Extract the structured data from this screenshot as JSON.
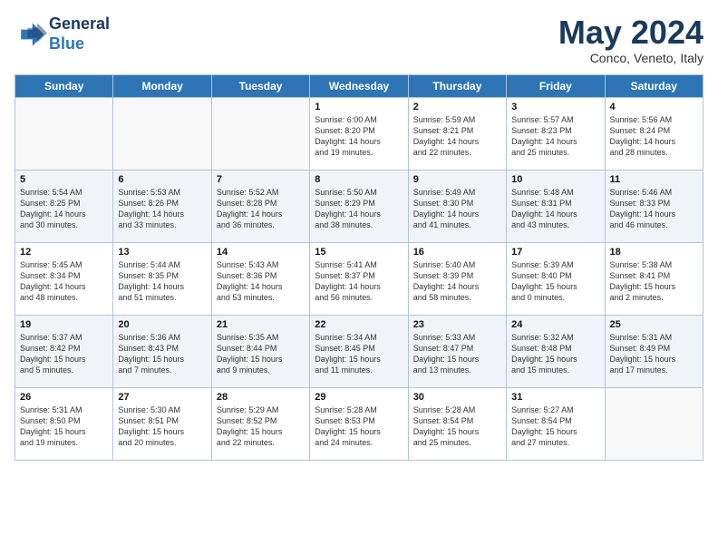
{
  "header": {
    "logo_line1": "General",
    "logo_line2": "Blue",
    "month": "May 2024",
    "location": "Conco, Veneto, Italy"
  },
  "days_of_week": [
    "Sunday",
    "Monday",
    "Tuesday",
    "Wednesday",
    "Thursday",
    "Friday",
    "Saturday"
  ],
  "weeks": [
    [
      {
        "day": "",
        "info": ""
      },
      {
        "day": "",
        "info": ""
      },
      {
        "day": "",
        "info": ""
      },
      {
        "day": "1",
        "info": "Sunrise: 6:00 AM\nSunset: 8:20 PM\nDaylight: 14 hours\nand 19 minutes."
      },
      {
        "day": "2",
        "info": "Sunrise: 5:59 AM\nSunset: 8:21 PM\nDaylight: 14 hours\nand 22 minutes."
      },
      {
        "day": "3",
        "info": "Sunrise: 5:57 AM\nSunset: 8:23 PM\nDaylight: 14 hours\nand 25 minutes."
      },
      {
        "day": "4",
        "info": "Sunrise: 5:56 AM\nSunset: 8:24 PM\nDaylight: 14 hours\nand 28 minutes."
      }
    ],
    [
      {
        "day": "5",
        "info": "Sunrise: 5:54 AM\nSunset: 8:25 PM\nDaylight: 14 hours\nand 30 minutes."
      },
      {
        "day": "6",
        "info": "Sunrise: 5:53 AM\nSunset: 8:26 PM\nDaylight: 14 hours\nand 33 minutes."
      },
      {
        "day": "7",
        "info": "Sunrise: 5:52 AM\nSunset: 8:28 PM\nDaylight: 14 hours\nand 36 minutes."
      },
      {
        "day": "8",
        "info": "Sunrise: 5:50 AM\nSunset: 8:29 PM\nDaylight: 14 hours\nand 38 minutes."
      },
      {
        "day": "9",
        "info": "Sunrise: 5:49 AM\nSunset: 8:30 PM\nDaylight: 14 hours\nand 41 minutes."
      },
      {
        "day": "10",
        "info": "Sunrise: 5:48 AM\nSunset: 8:31 PM\nDaylight: 14 hours\nand 43 minutes."
      },
      {
        "day": "11",
        "info": "Sunrise: 5:46 AM\nSunset: 8:33 PM\nDaylight: 14 hours\nand 46 minutes."
      }
    ],
    [
      {
        "day": "12",
        "info": "Sunrise: 5:45 AM\nSunset: 8:34 PM\nDaylight: 14 hours\nand 48 minutes."
      },
      {
        "day": "13",
        "info": "Sunrise: 5:44 AM\nSunset: 8:35 PM\nDaylight: 14 hours\nand 51 minutes."
      },
      {
        "day": "14",
        "info": "Sunrise: 5:43 AM\nSunset: 8:36 PM\nDaylight: 14 hours\nand 53 minutes."
      },
      {
        "day": "15",
        "info": "Sunrise: 5:41 AM\nSunset: 8:37 PM\nDaylight: 14 hours\nand 56 minutes."
      },
      {
        "day": "16",
        "info": "Sunrise: 5:40 AM\nSunset: 8:39 PM\nDaylight: 14 hours\nand 58 minutes."
      },
      {
        "day": "17",
        "info": "Sunrise: 5:39 AM\nSunset: 8:40 PM\nDaylight: 15 hours\nand 0 minutes."
      },
      {
        "day": "18",
        "info": "Sunrise: 5:38 AM\nSunset: 8:41 PM\nDaylight: 15 hours\nand 2 minutes."
      }
    ],
    [
      {
        "day": "19",
        "info": "Sunrise: 5:37 AM\nSunset: 8:42 PM\nDaylight: 15 hours\nand 5 minutes."
      },
      {
        "day": "20",
        "info": "Sunrise: 5:36 AM\nSunset: 8:43 PM\nDaylight: 15 hours\nand 7 minutes."
      },
      {
        "day": "21",
        "info": "Sunrise: 5:35 AM\nSunset: 8:44 PM\nDaylight: 15 hours\nand 9 minutes."
      },
      {
        "day": "22",
        "info": "Sunrise: 5:34 AM\nSunset: 8:45 PM\nDaylight: 15 hours\nand 11 minutes."
      },
      {
        "day": "23",
        "info": "Sunrise: 5:33 AM\nSunset: 8:47 PM\nDaylight: 15 hours\nand 13 minutes."
      },
      {
        "day": "24",
        "info": "Sunrise: 5:32 AM\nSunset: 8:48 PM\nDaylight: 15 hours\nand 15 minutes."
      },
      {
        "day": "25",
        "info": "Sunrise: 5:31 AM\nSunset: 8:49 PM\nDaylight: 15 hours\nand 17 minutes."
      }
    ],
    [
      {
        "day": "26",
        "info": "Sunrise: 5:31 AM\nSunset: 8:50 PM\nDaylight: 15 hours\nand 19 minutes."
      },
      {
        "day": "27",
        "info": "Sunrise: 5:30 AM\nSunset: 8:51 PM\nDaylight: 15 hours\nand 20 minutes."
      },
      {
        "day": "28",
        "info": "Sunrise: 5:29 AM\nSunset: 8:52 PM\nDaylight: 15 hours\nand 22 minutes."
      },
      {
        "day": "29",
        "info": "Sunrise: 5:28 AM\nSunset: 8:53 PM\nDaylight: 15 hours\nand 24 minutes."
      },
      {
        "day": "30",
        "info": "Sunrise: 5:28 AM\nSunset: 8:54 PM\nDaylight: 15 hours\nand 25 minutes."
      },
      {
        "day": "31",
        "info": "Sunrise: 5:27 AM\nSunset: 8:54 PM\nDaylight: 15 hours\nand 27 minutes."
      },
      {
        "day": "",
        "info": ""
      }
    ]
  ]
}
